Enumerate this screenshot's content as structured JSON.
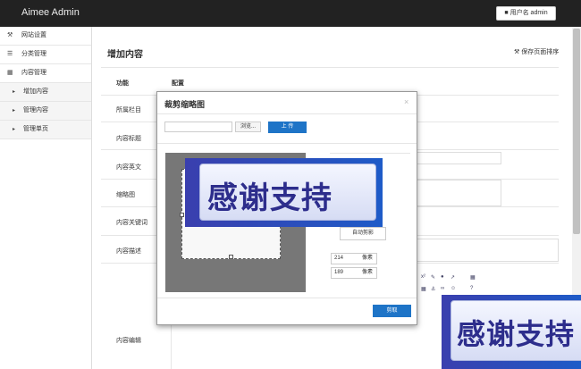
{
  "app": {
    "brand": "Aimee Admin",
    "user_label": "用户名 admin"
  },
  "sidebar": {
    "items": [
      {
        "label": "网站设置",
        "icon": "wrench-icon"
      },
      {
        "label": "分类管理",
        "icon": "list-icon"
      },
      {
        "label": "内容管理",
        "icon": "folder-icon"
      }
    ],
    "subitems": [
      {
        "label": "增加内容"
      },
      {
        "label": "管理内容"
      },
      {
        "label": "管理单页"
      }
    ]
  },
  "main": {
    "title": "增加内容",
    "sort_link": "保存页面排序",
    "col_func": "功能",
    "col_config": "配置",
    "rows": [
      "所属栏目",
      "内容标题",
      "内容英文",
      "缩略图",
      "内容关键词",
      "内容描述",
      "内容编辑"
    ]
  },
  "modal": {
    "title": "裁剪缩略图",
    "close": "×",
    "browse": "浏览...",
    "upload": "上 传",
    "auto_crop": "自动剪影",
    "width_value": "214",
    "height_value": "189",
    "unit": "像素",
    "cut_button": "剪取"
  },
  "overlay": {
    "text": "感谢支持"
  }
}
